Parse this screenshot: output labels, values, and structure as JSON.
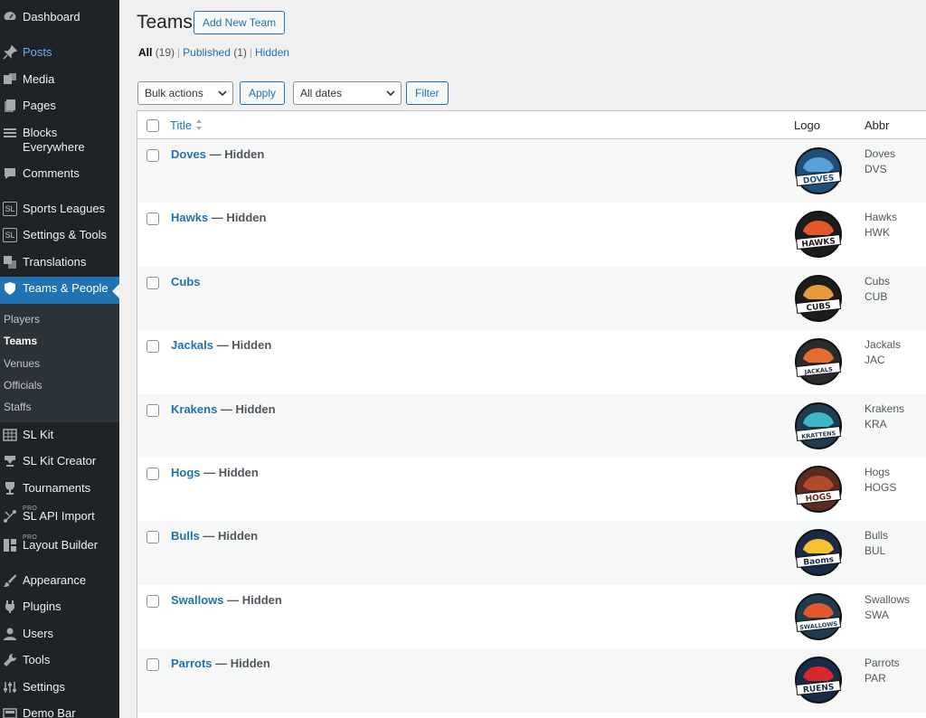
{
  "sidebar": {
    "items": [
      {
        "label": "Dashboard",
        "icon": "dashboard-icon"
      },
      {
        "label": "Posts",
        "icon": "pin-icon"
      },
      {
        "label": "Media",
        "icon": "media-icon"
      },
      {
        "label": "Pages",
        "icon": "page-icon"
      },
      {
        "label": "Blocks",
        "label2": "Everywhere",
        "icon": "list-icon"
      },
      {
        "label": "Comments",
        "icon": "comment-icon"
      },
      {
        "label": "Sports Leagues",
        "icon": "sl-icon",
        "icon_text": "SL"
      },
      {
        "label": "Settings & Tools",
        "icon": "sl-icon",
        "icon_text": "SL"
      },
      {
        "label": "Translations",
        "icon": "translate-icon"
      },
      {
        "label": "Teams & People",
        "icon": "shield-icon"
      },
      {
        "label": "SL Kit",
        "icon": "grid-icon"
      },
      {
        "label": "SL Kit Creator",
        "icon": "download-icon"
      },
      {
        "label": "Tournaments",
        "icon": "trophy-icon"
      },
      {
        "label": "SL API Import",
        "icon": "api-icon",
        "badge": "PRO"
      },
      {
        "label": "Layout Builder",
        "icon": "layout-icon",
        "badge": "PRO"
      },
      {
        "label": "Appearance",
        "icon": "brush-icon"
      },
      {
        "label": "Plugins",
        "icon": "plug-icon"
      },
      {
        "label": "Users",
        "icon": "user-icon"
      },
      {
        "label": "Tools",
        "icon": "wrench-icon"
      },
      {
        "label": "Settings",
        "icon": "settings-icon"
      },
      {
        "label": "Demo Bar",
        "icon": "demo-icon"
      }
    ],
    "submenu": [
      "Players",
      "Teams",
      "Venues",
      "Officials",
      "Staffs"
    ]
  },
  "header": {
    "title": "Teams",
    "add_new": "Add New Team"
  },
  "filters": {
    "all": "All",
    "all_count": "(19)",
    "published": "Published",
    "published_count": "(1)",
    "hidden": "Hidden",
    "separator": "|",
    "bulk_actions": "Bulk actions",
    "apply": "Apply",
    "all_dates": "All dates",
    "filter": "Filter"
  },
  "table": {
    "col_title": "Title",
    "col_logo": "Logo",
    "col_abbr": "Abbr",
    "state_sep": " — ",
    "rows": [
      {
        "name": "Doves",
        "state": "Hidden",
        "abbr_long": "Doves",
        "abbr_short": "DVS",
        "logo_text": "DOVES",
        "color": "#1f4e79",
        "accent": "#5aa0d8"
      },
      {
        "name": "Hawks",
        "state": "Hidden",
        "abbr_long": "Hawks",
        "abbr_short": "HWK",
        "logo_text": "HAWKS",
        "color": "#1c1c1c",
        "accent": "#e2572b"
      },
      {
        "name": "Cubs",
        "state": "",
        "abbr_long": "Cubs",
        "abbr_short": "CUB",
        "logo_text": "CUBS",
        "color": "#1c1c1c",
        "accent": "#e69a3c"
      },
      {
        "name": "Jackals",
        "state": "Hidden",
        "abbr_long": "Jackals",
        "abbr_short": "JAC",
        "logo_text": "JACKALS",
        "color": "#2b2b2b",
        "accent": "#e46c2e"
      },
      {
        "name": "Krakens",
        "state": "Hidden",
        "abbr_long": "Krakens",
        "abbr_short": "KRA",
        "logo_text": "KRATTENS",
        "color": "#1f3b4d",
        "accent": "#3fb6c6"
      },
      {
        "name": "Hogs",
        "state": "Hidden",
        "abbr_long": "Hogs",
        "abbr_short": "HOGS",
        "logo_text": "HOGS",
        "color": "#5a2b1e",
        "accent": "#b04a2a"
      },
      {
        "name": "Bulls",
        "state": "Hidden",
        "abbr_long": "Bulls",
        "abbr_short": "BUL",
        "logo_text": "Baoms",
        "color": "#1a2b4a",
        "accent": "#f2c230"
      },
      {
        "name": "Swallows",
        "state": "Hidden",
        "abbr_long": "Swallows",
        "abbr_short": "SWA",
        "logo_text": "SWALLOWS",
        "color": "#1f3b4d",
        "accent": "#e4572e"
      },
      {
        "name": "Parrots",
        "state": "Hidden",
        "abbr_long": "Parrots",
        "abbr_short": "PAR",
        "logo_text": "RUENS",
        "color": "#1a2b4a",
        "accent": "#d9272e"
      }
    ]
  },
  "colors": {
    "sidebar_bg": "#1d2327",
    "active_bg": "#2271b1",
    "link": "#2271b1"
  }
}
